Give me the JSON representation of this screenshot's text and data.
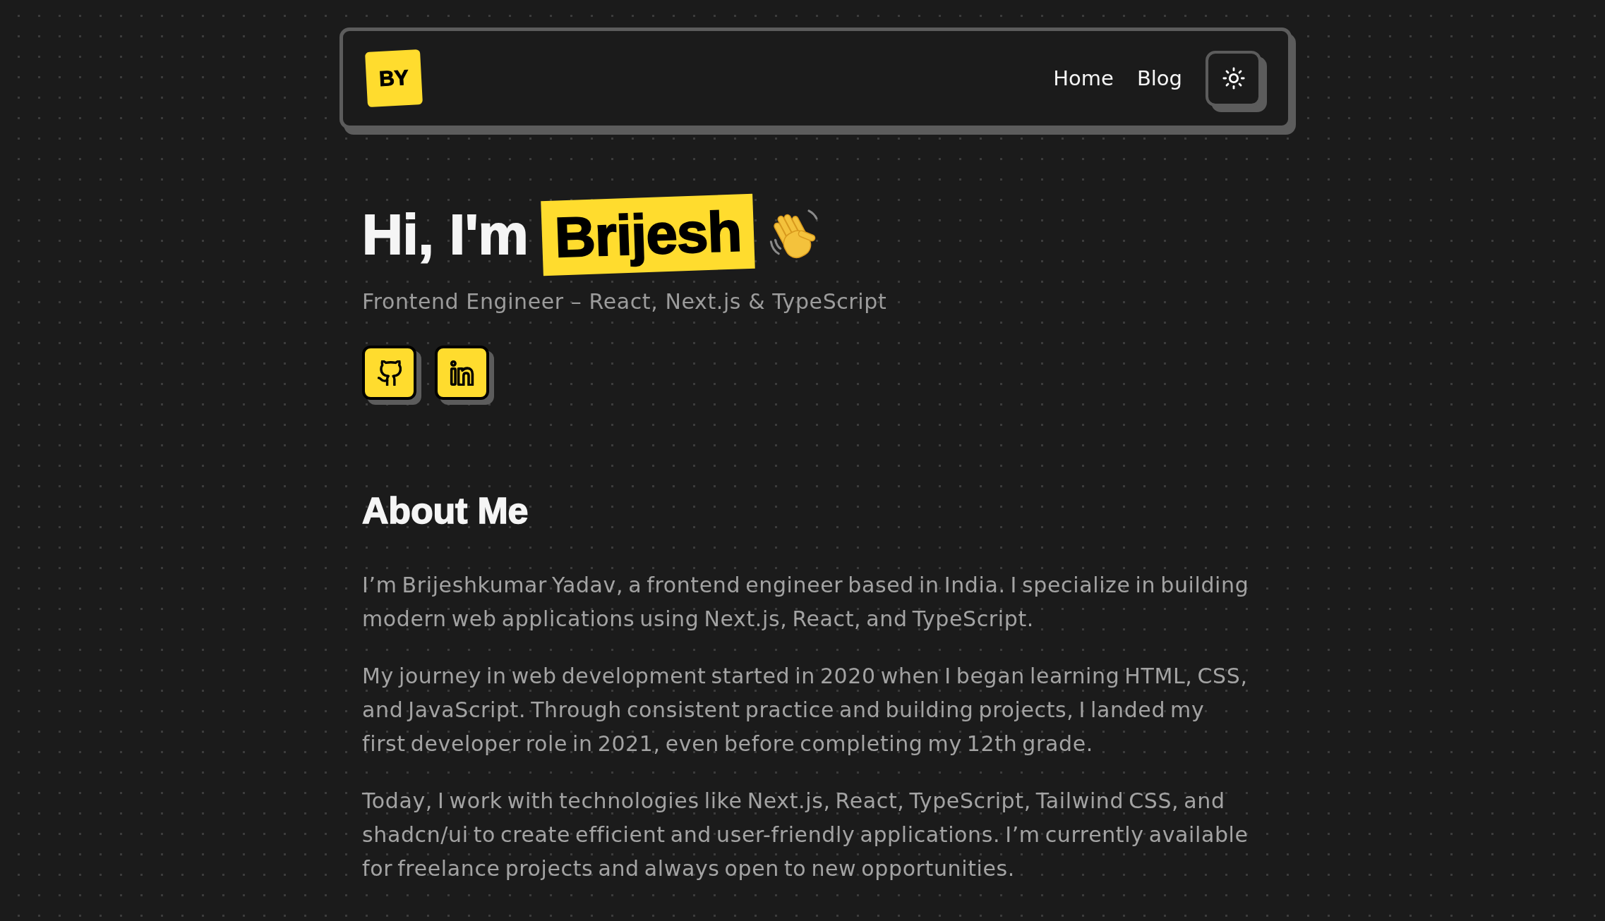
{
  "header": {
    "logo": "BY",
    "nav_links": [
      {
        "label": "Home"
      },
      {
        "label": "Blog"
      }
    ]
  },
  "hero": {
    "greeting": "Hi, I'm",
    "name": "Brijesh",
    "subtitle": "Frontend Engineer – React, Next.js & TypeScript",
    "social_links": [
      {
        "kind": "github"
      },
      {
        "kind": "linkedin"
      }
    ]
  },
  "about": {
    "title": "About Me",
    "paragraphs": [
      "I’m Brijeshkumar Yadav, a frontend engineer based in India. I specialize in building modern web applications using Next.js, React, and TypeScript.",
      "My journey in web development started in 2020 when I began learning HTML, CSS, and JavaScript. Through consistent practice and building projects, I landed my first developer role in 2021, even before completing my 12th grade.",
      "Today, I work with technologies like Next.js, React, TypeScript, Tailwind CSS, and shadcn/ui to create efficient and user-friendly applications. I’m currently available for freelance projects and always open to new opportunities."
    ]
  }
}
